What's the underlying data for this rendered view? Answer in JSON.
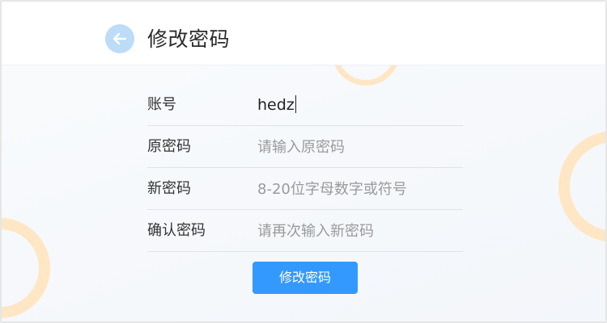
{
  "header": {
    "title": "修改密码",
    "back_icon": "arrow-left-icon"
  },
  "form": {
    "account": {
      "label": "账号",
      "value": "hedz"
    },
    "old_password": {
      "label": "原密码",
      "placeholder": "请输入原密码"
    },
    "new_password": {
      "label": "新密码",
      "placeholder": "8-20位字母数字或符号"
    },
    "confirm_password": {
      "label": "确认密码",
      "placeholder": "请再次输入新密码"
    },
    "submit_label": "修改密码"
  },
  "colors": {
    "accent": "#3399ff",
    "back_button": "#bcdcf7",
    "decor_ring": "#ffe6c4"
  }
}
